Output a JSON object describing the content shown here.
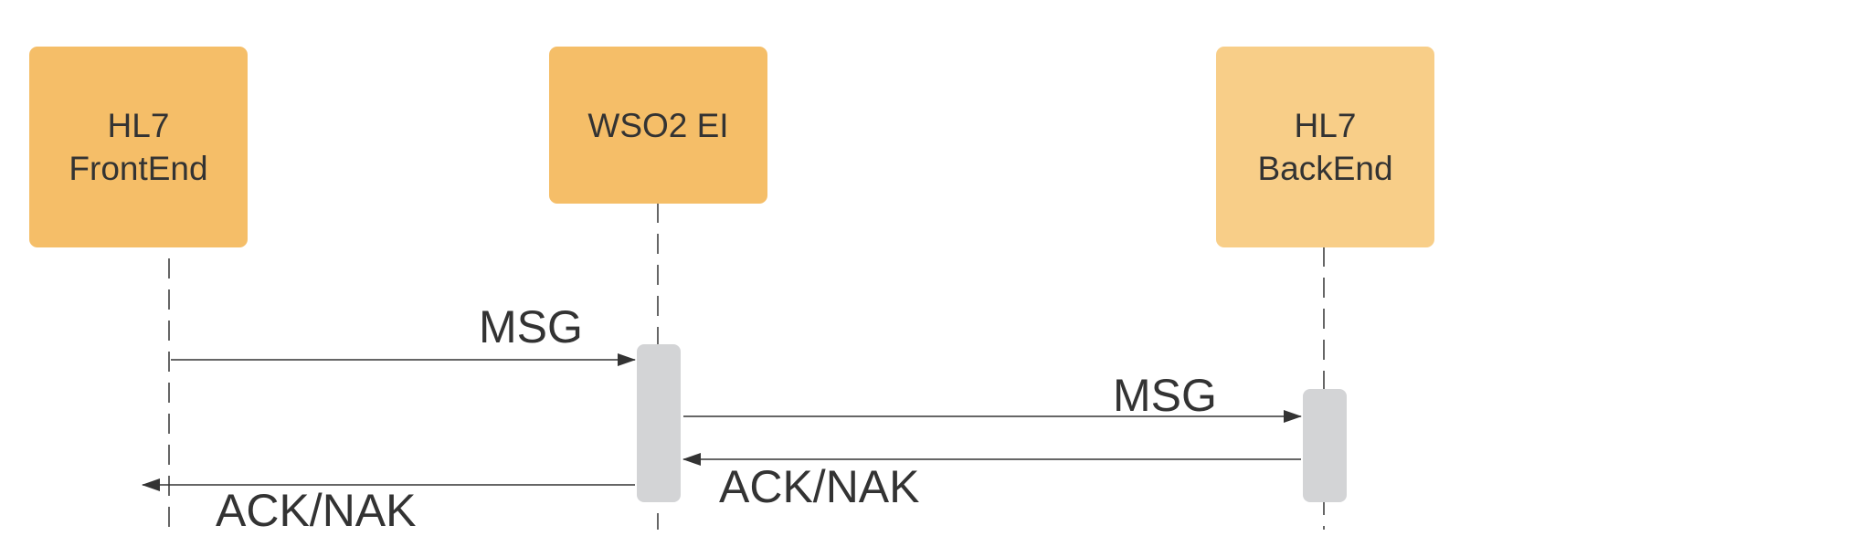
{
  "colors": {
    "actor_primary": "#f5be68",
    "actor_light": "#f8ce88",
    "activation": "#d3d4d6",
    "line": "#333333",
    "text": "#333333"
  },
  "actors": [
    {
      "id": "frontend",
      "label": "HL7\nFrontEnd"
    },
    {
      "id": "ei",
      "label": "WSO2 EI"
    },
    {
      "id": "backend",
      "label": "HL7\nBackEnd"
    }
  ],
  "messages": [
    {
      "id": "msg-1",
      "label": "MSG",
      "from": "HL7 FrontEnd",
      "to": "WSO2 EI"
    },
    {
      "id": "msg-2",
      "label": "MSG",
      "from": "WSO2 EI",
      "to": "HL7 BackEnd"
    },
    {
      "id": "ack-1",
      "label": "ACK/NAK",
      "from": "HL7 BackEnd",
      "to": "WSO2 EI"
    },
    {
      "id": "ack-2",
      "label": "ACK/NAK",
      "from": "WSO2 EI",
      "to": "HL7 FrontEnd"
    }
  ]
}
